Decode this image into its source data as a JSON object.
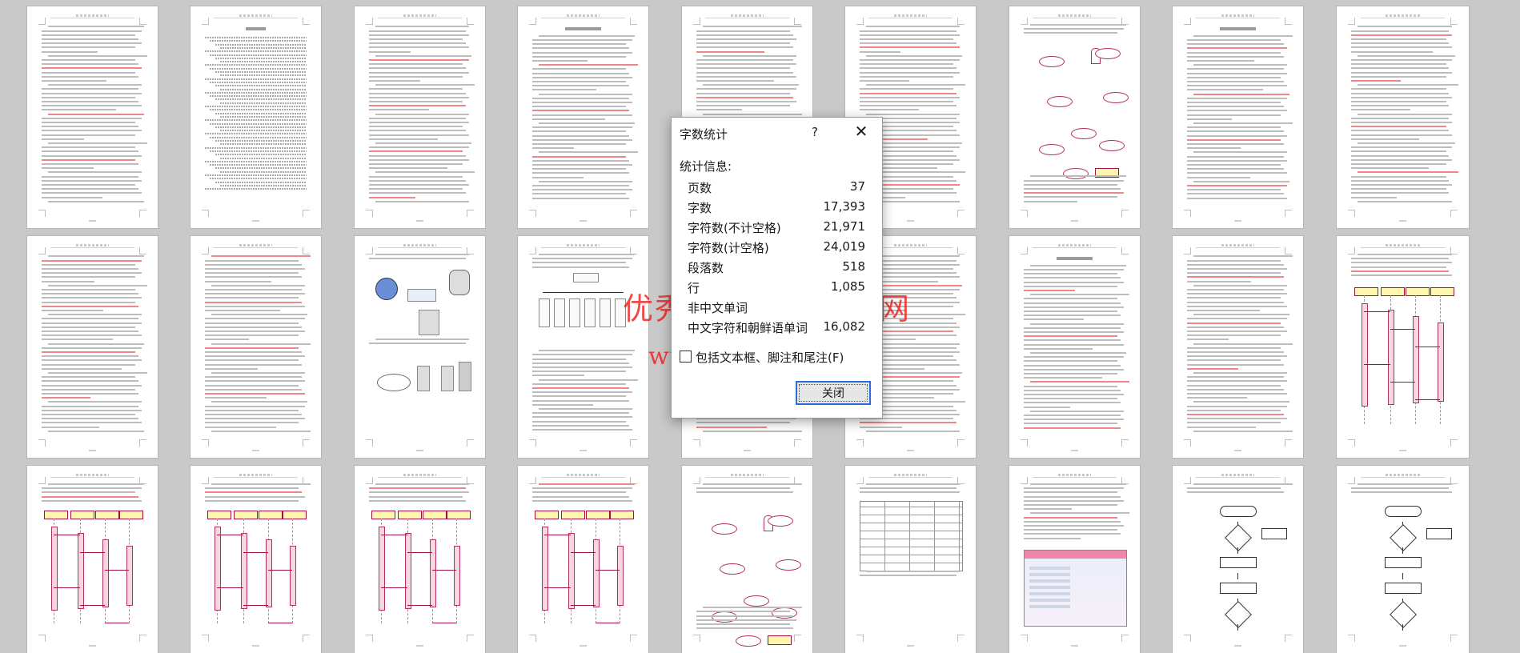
{
  "dialog": {
    "title": "字数统计",
    "help_label": "?",
    "close_label": "✕",
    "section_label": "统计信息:",
    "stats": [
      {
        "label": "页数",
        "value": "37"
      },
      {
        "label": "字数",
        "value": "17,393"
      },
      {
        "label": "字符数(不计空格)",
        "value": "21,971"
      },
      {
        "label": "字符数(计空格)",
        "value": "24,019"
      },
      {
        "label": "段落数",
        "value": "518"
      },
      {
        "label": "行",
        "value": "1,085"
      },
      {
        "label": "非中文单词",
        "value": ""
      },
      {
        "label": "中文字符和朝鲜语单词",
        "value": "16,082"
      }
    ],
    "checkbox_label": "包括文本框、脚注和尾注(F)",
    "checkbox_checked": false,
    "close_button_label": "关闭"
  },
  "watermark": {
    "line1": "优秀毕业设计资源网",
    "line2": "www.keylead.cn"
  },
  "colors": {
    "accent": "#2a6fd6",
    "watermark": "#ee2020",
    "diagram": "#a01040"
  }
}
